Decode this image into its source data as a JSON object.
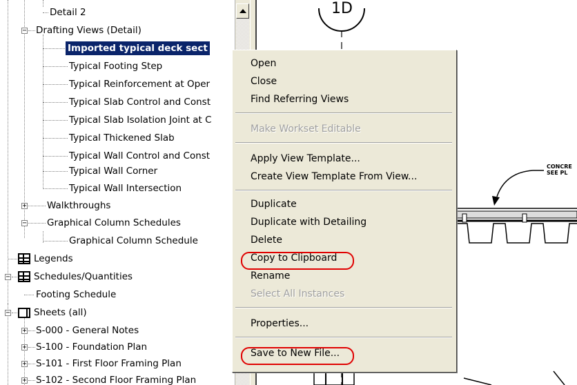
{
  "tree": {
    "items": [
      {
        "label": "Detail 2"
      },
      {
        "label": "Drafting Views (Detail)",
        "expander": "−"
      },
      {
        "label": "Imported typical deck sect",
        "selected": true
      },
      {
        "label": "Typical Footing Step"
      },
      {
        "label": "Typical Reinforcement at Oper"
      },
      {
        "label": "Typical Slab Control and Const"
      },
      {
        "label": "Typical Slab Isolation Joint at C"
      },
      {
        "label": "Typical Thickened Slab"
      },
      {
        "label": "Typical Wall Control and Const"
      },
      {
        "label": "Typical Wall Corner"
      },
      {
        "label": "Typical Wall Intersection"
      },
      {
        "label": "Walkthroughs",
        "expander": "+"
      },
      {
        "label": "Graphical Column Schedules",
        "expander": "−"
      },
      {
        "label": "Graphical Column Schedule"
      },
      {
        "label": "Legends"
      },
      {
        "label": "Schedules/Quantities",
        "expander": "−"
      },
      {
        "label": "Footing Schedule"
      },
      {
        "label": "Sheets (all)",
        "expander": "−"
      },
      {
        "label": "S-000 - General Notes",
        "expander": "+"
      },
      {
        "label": "S-100 - Foundation Plan",
        "expander": "+"
      },
      {
        "label": "S-101 - First Floor Framing Plan",
        "expander": "+"
      },
      {
        "label": "S-102 - Second Floor Framing Plan",
        "expander": "+"
      }
    ]
  },
  "drawing": {
    "tag": "1D",
    "note_line1": "CONCRE",
    "note_line2": "SEE PL"
  },
  "context_menu": {
    "open": "Open",
    "close": "Close",
    "find_referring_views": "Find Referring Views",
    "make_workset_editable": "Make Workset Editable",
    "apply_view_template": "Apply View Template...",
    "create_view_template": "Create View Template From View...",
    "duplicate": "Duplicate",
    "duplicate_with_detailing": "Duplicate with Detailing",
    "delete": "Delete",
    "copy_to_clipboard": "Copy to Clipboard",
    "rename": "Rename",
    "select_all_instances": "Select All Instances",
    "properties": "Properties...",
    "save_to_new_file": "Save to New File..."
  },
  "highlight_color": "#e00000",
  "selection_color": "#0a246a"
}
